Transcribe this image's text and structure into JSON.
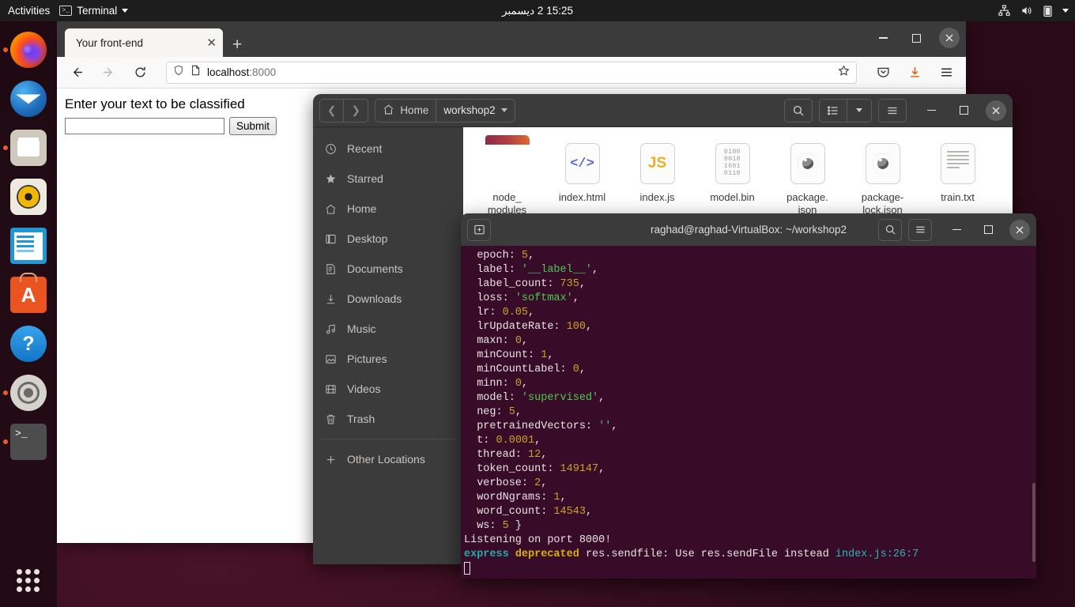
{
  "topbar": {
    "activities": "Activities",
    "app_menu": "Terminal",
    "clock": "15:25 2 ديسمبر",
    "tray_icons": [
      "network-icon",
      "volume-icon",
      "battery-icon",
      "chevron-down-icon"
    ]
  },
  "dock": {
    "items": [
      {
        "name": "firefox",
        "label": "Firefox",
        "running": true
      },
      {
        "name": "thunderbird",
        "label": "Thunderbird",
        "running": false
      },
      {
        "name": "files",
        "label": "Files",
        "running": true
      },
      {
        "name": "rhythmbox",
        "label": "Rhythmbox",
        "running": false
      },
      {
        "name": "libreoffice-writer",
        "label": "LibreOffice Writer",
        "running": false
      },
      {
        "name": "ubuntu-software",
        "label": "Ubuntu Software",
        "running": false
      },
      {
        "name": "help",
        "label": "Help",
        "running": false
      },
      {
        "name": "settings",
        "label": "Settings",
        "running": true
      },
      {
        "name": "terminal",
        "label": "Terminal",
        "running": true
      }
    ],
    "show_apps_label": "Show Applications"
  },
  "firefox": {
    "tab_title": "Your front-end",
    "tab_close_glyph": "✕",
    "new_tab_glyph": "+",
    "url": "localhost",
    "url_port": ":8000",
    "toolbar_icons": [
      "pocket-icon",
      "downloads-icon",
      "menu-icon"
    ],
    "page": {
      "heading": "Enter your text to be classified",
      "input_value": "",
      "input_placeholder": "",
      "submit_label": "Submit"
    }
  },
  "files": {
    "path_home": "Home",
    "path_current": "workshop2",
    "sidebar": [
      {
        "label": "Recent",
        "icon": "clock-icon"
      },
      {
        "label": "Starred",
        "icon": "star-icon"
      },
      {
        "label": "Home",
        "icon": "home-icon"
      },
      {
        "label": "Desktop",
        "icon": "desktop-icon"
      },
      {
        "label": "Documents",
        "icon": "document-icon"
      },
      {
        "label": "Downloads",
        "icon": "download-icon"
      },
      {
        "label": "Music",
        "icon": "music-icon"
      },
      {
        "label": "Pictures",
        "icon": "picture-icon"
      },
      {
        "label": "Videos",
        "icon": "video-icon"
      },
      {
        "label": "Trash",
        "icon": "trash-icon"
      }
    ],
    "other_locations": "Other Locations",
    "items": [
      {
        "name": "node_\nmodules",
        "type": "folder"
      },
      {
        "name": "index.html",
        "type": "html",
        "glyph": "</>"
      },
      {
        "name": "index.js",
        "type": "js",
        "glyph": "JS"
      },
      {
        "name": "model.bin",
        "type": "bin",
        "glyph": "0100\n0010\n1001\n0110"
      },
      {
        "name": "package.\njson",
        "type": "json"
      },
      {
        "name": "package-\nlock.json",
        "type": "json"
      },
      {
        "name": "train.txt",
        "type": "txt"
      }
    ]
  },
  "terminal": {
    "title": "raghad@raghad-VirtualBox: ~/workshop2",
    "lines": [
      {
        "parts": [
          {
            "t": "  epoch: ",
            "c": "key"
          },
          {
            "t": "5",
            "c": "num"
          },
          {
            "t": ",",
            "c": "key"
          }
        ]
      },
      {
        "parts": [
          {
            "t": "  label: ",
            "c": "key"
          },
          {
            "t": "'__label__'",
            "c": "str"
          },
          {
            "t": ",",
            "c": "key"
          }
        ]
      },
      {
        "parts": [
          {
            "t": "  label_count: ",
            "c": "key"
          },
          {
            "t": "735",
            "c": "num"
          },
          {
            "t": ",",
            "c": "key"
          }
        ]
      },
      {
        "parts": [
          {
            "t": "  loss: ",
            "c": "key"
          },
          {
            "t": "'softmax'",
            "c": "str"
          },
          {
            "t": ",",
            "c": "key"
          }
        ]
      },
      {
        "parts": [
          {
            "t": "  lr: ",
            "c": "key"
          },
          {
            "t": "0.05",
            "c": "num"
          },
          {
            "t": ",",
            "c": "key"
          }
        ]
      },
      {
        "parts": [
          {
            "t": "  lrUpdateRate: ",
            "c": "key"
          },
          {
            "t": "100",
            "c": "num"
          },
          {
            "t": ",",
            "c": "key"
          }
        ]
      },
      {
        "parts": [
          {
            "t": "  maxn: ",
            "c": "key"
          },
          {
            "t": "0",
            "c": "num"
          },
          {
            "t": ",",
            "c": "key"
          }
        ]
      },
      {
        "parts": [
          {
            "t": "  minCount: ",
            "c": "key"
          },
          {
            "t": "1",
            "c": "num"
          },
          {
            "t": ",",
            "c": "key"
          }
        ]
      },
      {
        "parts": [
          {
            "t": "  minCountLabel: ",
            "c": "key"
          },
          {
            "t": "0",
            "c": "num"
          },
          {
            "t": ",",
            "c": "key"
          }
        ]
      },
      {
        "parts": [
          {
            "t": "  minn: ",
            "c": "key"
          },
          {
            "t": "0",
            "c": "num"
          },
          {
            "t": ",",
            "c": "key"
          }
        ]
      },
      {
        "parts": [
          {
            "t": "  model: ",
            "c": "key"
          },
          {
            "t": "'supervised'",
            "c": "str"
          },
          {
            "t": ",",
            "c": "key"
          }
        ]
      },
      {
        "parts": [
          {
            "t": "  neg: ",
            "c": "key"
          },
          {
            "t": "5",
            "c": "num"
          },
          {
            "t": ",",
            "c": "key"
          }
        ]
      },
      {
        "parts": [
          {
            "t": "  pretrainedVectors: ",
            "c": "key"
          },
          {
            "t": "''",
            "c": "str"
          },
          {
            "t": ",",
            "c": "key"
          }
        ]
      },
      {
        "parts": [
          {
            "t": "  t: ",
            "c": "key"
          },
          {
            "t": "0.0001",
            "c": "num"
          },
          {
            "t": ",",
            "c": "key"
          }
        ]
      },
      {
        "parts": [
          {
            "t": "  thread: ",
            "c": "key"
          },
          {
            "t": "12",
            "c": "num"
          },
          {
            "t": ",",
            "c": "key"
          }
        ]
      },
      {
        "parts": [
          {
            "t": "  token_count: ",
            "c": "key"
          },
          {
            "t": "149147",
            "c": "num"
          },
          {
            "t": ",",
            "c": "key"
          }
        ]
      },
      {
        "parts": [
          {
            "t": "  verbose: ",
            "c": "key"
          },
          {
            "t": "2",
            "c": "num"
          },
          {
            "t": ",",
            "c": "key"
          }
        ]
      },
      {
        "parts": [
          {
            "t": "  wordNgrams: ",
            "c": "key"
          },
          {
            "t": "1",
            "c": "num"
          },
          {
            "t": ",",
            "c": "key"
          }
        ]
      },
      {
        "parts": [
          {
            "t": "  word_count: ",
            "c": "key"
          },
          {
            "t": "14543",
            "c": "num"
          },
          {
            "t": ",",
            "c": "key"
          }
        ]
      },
      {
        "parts": [
          {
            "t": "  ws: ",
            "c": "key"
          },
          {
            "t": "5",
            "c": "num"
          },
          {
            "t": " }",
            "c": "key"
          }
        ]
      },
      {
        "parts": [
          {
            "t": "Listening on port 8000!",
            "c": "key"
          }
        ]
      },
      {
        "parts": [
          {
            "t": "express",
            "c": "cyan"
          },
          {
            "t": " ",
            "c": "key"
          },
          {
            "t": "deprecated",
            "c": "yellow"
          },
          {
            "t": " res.sendfile: Use res.sendFile instead ",
            "c": "key"
          },
          {
            "t": "index.js:26:7",
            "c": "link"
          }
        ]
      }
    ]
  }
}
